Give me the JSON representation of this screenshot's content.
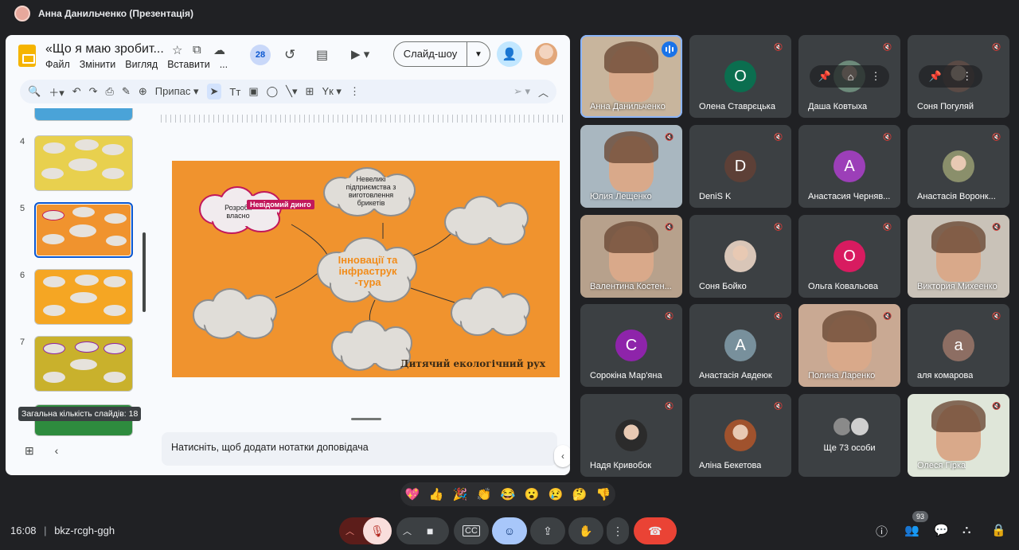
{
  "meeting": {
    "presenter_title": "Анна Данильченко (Презентація)",
    "time": "16:08",
    "code": "bkz-rcgh-ggh",
    "participant_count": "93"
  },
  "doc": {
    "title": "«Що я маю зробит...",
    "menu": [
      "Файл",
      "Змінити",
      "Вигляд",
      "Вставити",
      "..."
    ],
    "collaborators_badge": "28",
    "slideshow_label": "Слайд-шоу",
    "toolbar_fit": "Припас"
  },
  "filmstrip": {
    "slides": [
      {
        "num": "4",
        "color": "#e8d04e"
      },
      {
        "num": "5",
        "color": "#f0932e"
      },
      {
        "num": "6",
        "color": "#f5a623"
      },
      {
        "num": "7",
        "color": "#c9b12c"
      }
    ],
    "tooltip": "Загальна кількість слайдів: 18"
  },
  "slide": {
    "background": "#f0932e",
    "center_text": "Інновації та інфраструк -тура",
    "cloud_top": "Невеликі підприємства з виготовлення брикетів",
    "cloud_left": "Розробк власно",
    "collaborator_cursor": "Невідомий динго",
    "footer": "Дитячий екологічний рух"
  },
  "notes_placeholder": "Натисніть, щоб додати нотатки доповідача",
  "participants": [
    {
      "name": "Анна Данильченко",
      "type": "video",
      "bg": "#c8b59d"
    },
    {
      "name": "Олена Ставрєцька",
      "type": "letter",
      "letter": "О",
      "color": "#0b6e4f"
    },
    {
      "name": "Даша Ковтыха",
      "type": "photo",
      "color": "#6c8a7a"
    },
    {
      "name": "Соня Погуляй",
      "type": "photo",
      "color": "#5a4a45"
    },
    {
      "name": "Юлия Лещенко",
      "type": "video",
      "bg": "#a9b7c0"
    },
    {
      "name": "DeniS K",
      "type": "letter",
      "letter": "D",
      "color": "#5d4037"
    },
    {
      "name": "Анастасия Черняв...",
      "type": "letter",
      "letter": "А",
      "color": "#9c3fb8"
    },
    {
      "name": "Анастасія Воронк...",
      "type": "photo",
      "color": "#8a8f6b"
    },
    {
      "name": "Валентина Костен...",
      "type": "video",
      "bg": "#b7a18c"
    },
    {
      "name": "Соня Бойко",
      "type": "photo",
      "color": "#d9c6b8"
    },
    {
      "name": "Ольга Ковальова",
      "type": "letter",
      "letter": "О",
      "color": "#d81b60"
    },
    {
      "name": "Виктория Михеенко",
      "type": "video",
      "bg": "#c9c2b8"
    },
    {
      "name": "Сорокіна Мар'яна",
      "type": "letter",
      "letter": "С",
      "color": "#8e24aa"
    },
    {
      "name": "Анастасія Авдеюк",
      "type": "letter",
      "letter": "А",
      "color": "#78909c"
    },
    {
      "name": "Полина Ларенко",
      "type": "video",
      "bg": "#c9a993"
    },
    {
      "name": "аля комарова",
      "type": "letter",
      "letter": "a",
      "color": "#8d6e63"
    },
    {
      "name": "Надя Кривобок",
      "type": "photo",
      "color": "#2b2b2b"
    },
    {
      "name": "Аліна Бекетова",
      "type": "photo",
      "color": "#a0522d"
    },
    {
      "name": "Ще 73 особи",
      "type": "more"
    },
    {
      "name": "Олеся Гірка",
      "type": "video",
      "bg": "#dfe6d9"
    }
  ],
  "reactions": [
    "💖",
    "👍",
    "🎉",
    "👏",
    "😂",
    "😮",
    "😢",
    "🤔",
    "👎"
  ],
  "icons": {
    "mic_off": "mic-off-icon",
    "camera": "camera-icon",
    "captions": "captions-icon",
    "emoji": "emoji-icon",
    "present": "present-icon",
    "hand": "raise-hand-icon",
    "more": "more-vert-icon",
    "end": "end-call-icon"
  }
}
